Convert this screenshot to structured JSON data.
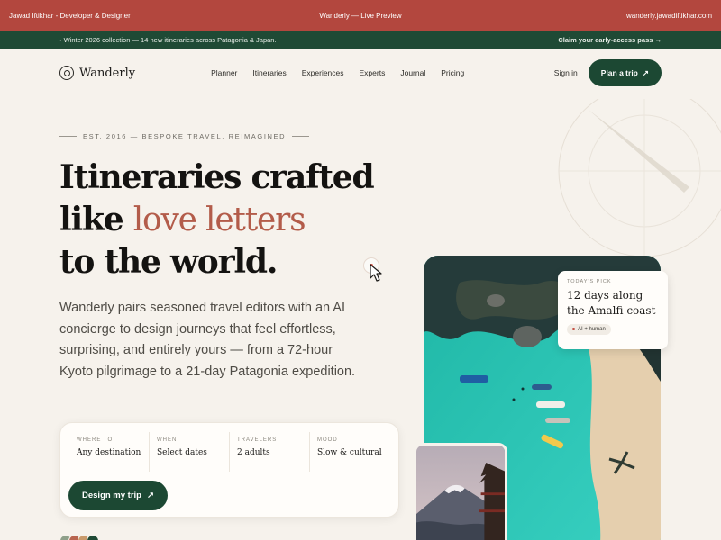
{
  "frame": {
    "left": "Jawad Iftikhar - Developer & Designer",
    "center": "Wanderly — Live Preview",
    "right": "wanderly.jawadiftikhar.com"
  },
  "announcement": {
    "text": "Winter 2026 collection — 14 new itineraries across Patagonia & Japan.",
    "cta": "Claim your early-access pass →"
  },
  "nav": {
    "brand": "Wanderly",
    "links": [
      "Planner",
      "Itineraries",
      "Experiences",
      "Experts",
      "Journal",
      "Pricing"
    ],
    "signin": "Sign in",
    "cta": "Plan a trip",
    "cta_arrow": "↗"
  },
  "hero": {
    "eyebrow": "EST. 2016 — BESPOKE TRAVEL, REIMAGINED",
    "headline_1": "Itineraries crafted",
    "headline_2a": "like ",
    "headline_2b": "love letters",
    "headline_3": "to the world.",
    "description": "Wanderly pairs seasoned travel editors with an AI concierge to design journeys that feel effortless, surprising, and entirely yours — from a 72-hour Kyoto pilgrimage to a 21-day Patagonia expedition."
  },
  "booking": {
    "fields": [
      {
        "label": "WHERE TO",
        "value": "Any destination"
      },
      {
        "label": "WHEN",
        "value": "Select dates"
      },
      {
        "label": "TRAVELERS",
        "value": "2 adults"
      },
      {
        "label": "MOOD",
        "value": "Slow & cultural"
      }
    ],
    "cta": "Design my trip",
    "cta_arrow": "↗"
  },
  "pick": {
    "label": "TODAY'S PICK",
    "title": "12 days along the Amalfi coast",
    "tag": "AI + human"
  },
  "colors": {
    "frame": "#b3473e",
    "brand_green": "#1c4833",
    "accent": "#b35c4a",
    "background": "#f6f2ec"
  }
}
